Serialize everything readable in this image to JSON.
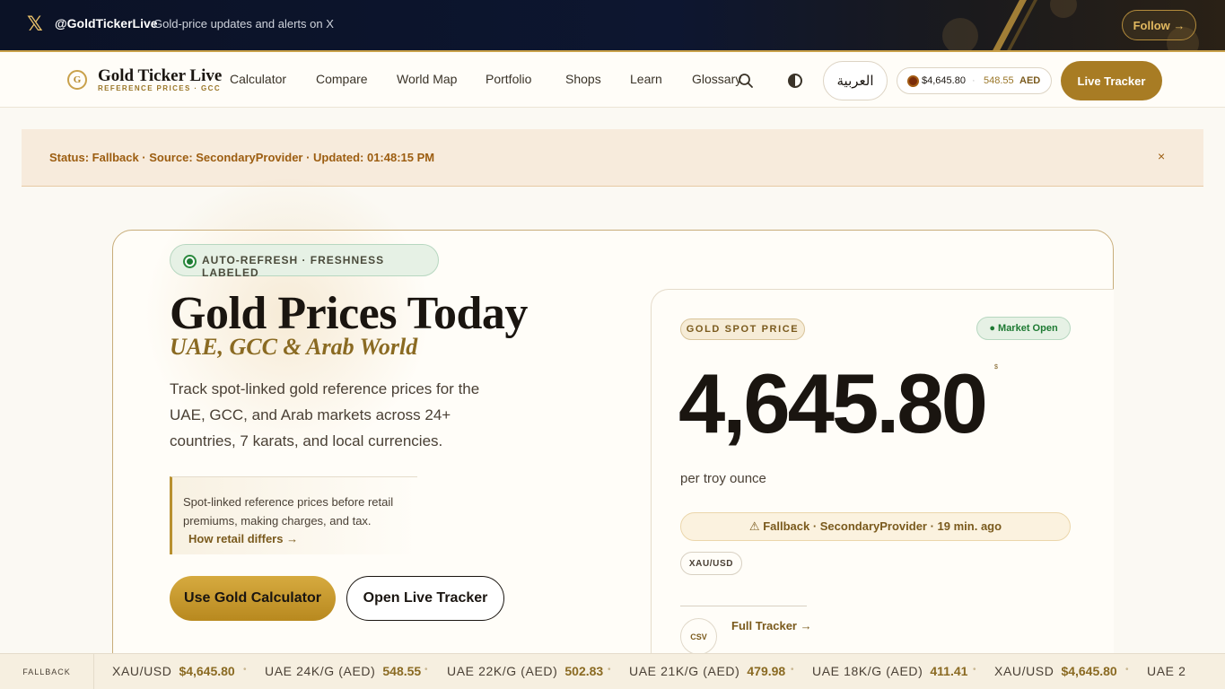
{
  "xbar": {
    "handle": "@GoldTickerLive",
    "tagline": "Gold-price updates and alerts on X",
    "follow": "Follow →"
  },
  "brand": {
    "mark": "G",
    "name": "Gold Ticker Live",
    "sub": "REFERENCE PRICES · GCC"
  },
  "nav": {
    "items": [
      "Calculator",
      "Compare",
      "World Map",
      "Portfolio",
      "Shops",
      "Learn",
      "Glossary"
    ],
    "lang": "العربية",
    "ticker_usd": "$4,645.80",
    "ticker_aed_value": "548.55",
    "ticker_aed_currency": "AED",
    "live_tracker": "Live Tracker"
  },
  "status": {
    "text": "Status: Fallback · Source: SecondaryProvider · Updated: 01:48:15 PM",
    "close": "×"
  },
  "hero": {
    "badge": "AUTO-REFRESH · FRESHNESS LABELED",
    "title": "Gold Prices Today",
    "subtitle": "UAE, GCC & Arab World",
    "lead": "Track spot-linked gold reference prices for the UAE, GCC, and Arab markets across 24+ countries, 7 karats, and local currencies.",
    "note": "Spot-linked reference prices before retail premiums, making charges, and tax.",
    "note_link": "How retail differs →",
    "cta_primary": "Use Gold Calculator",
    "cta_secondary": "Open Live Tracker"
  },
  "spot": {
    "label": "GOLD SPOT PRICE",
    "market": "● Market Open",
    "price": "4,645.80",
    "currency": "$",
    "unit": "per troy ounce",
    "fallback": "⚠ Fallback · SecondaryProvider · 19 min. ago",
    "pair": "XAU/USD",
    "csv": "CSV",
    "full_tracker": "Full Tracker →"
  },
  "bottom_ticker": {
    "status": "FALLBACK",
    "items": [
      {
        "label": "XAU/USD",
        "value": "$4,645.80"
      },
      {
        "label": "UAE 24K/G (AED)",
        "value": "548.55"
      },
      {
        "label": "UAE 22K/G (AED)",
        "value": "502.83"
      },
      {
        "label": "UAE 21K/G (AED)",
        "value": "479.98"
      },
      {
        "label": "UAE 18K/G (AED)",
        "value": "411.41"
      },
      {
        "label": "XAU/USD",
        "value": "$4,645.80"
      },
      {
        "label": "UAE 2",
        "value": ""
      }
    ]
  },
  "colors": {
    "gold": "#a87c24",
    "navy": "#0b1226",
    "status_bg": "#f7ebdc",
    "status_text": "#9c5d10",
    "market_green": "#1e7a33"
  }
}
